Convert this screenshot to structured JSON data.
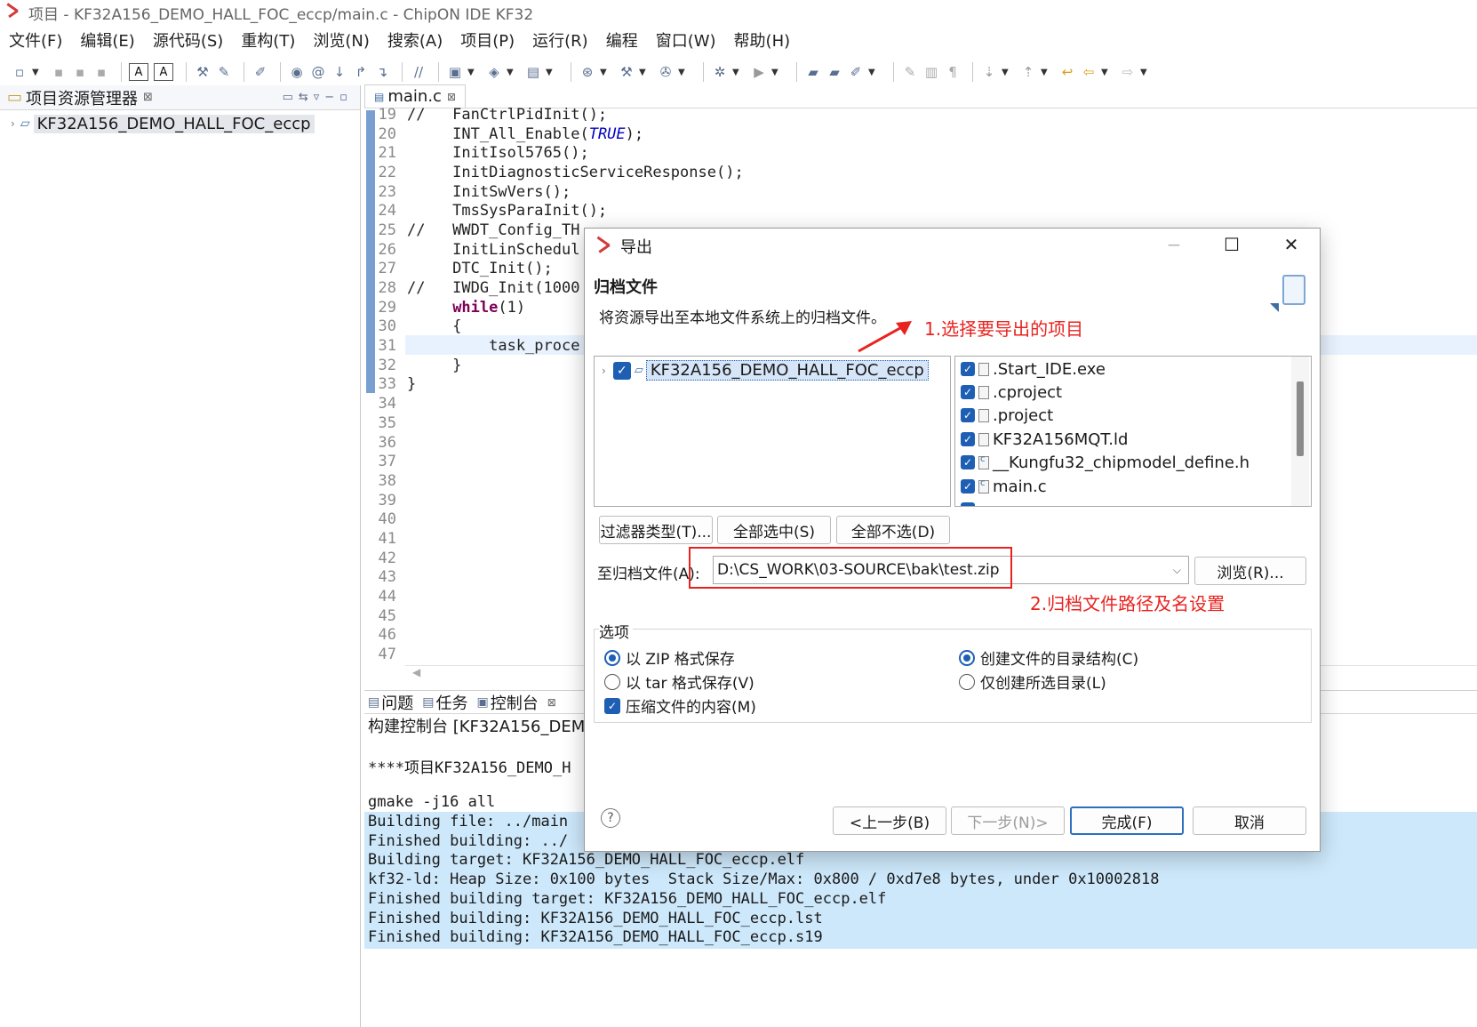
{
  "window": {
    "title": "项目  -  KF32A156_DEMO_HALL_FOC_eccp/main.c  -  ChipON IDE KF32"
  },
  "menu": [
    "文件(F)",
    "编辑(E)",
    "源代码(S)",
    "重构(T)",
    "浏览(N)",
    "搜索(A)",
    "项目(P)",
    "运行(R)",
    "编程",
    "窗口(W)",
    "帮助(H)"
  ],
  "explorer": {
    "title": "项目资源管理器",
    "project": "KF32A156_DEMO_HALL_FOC_eccp"
  },
  "editor": {
    "tab": "main.c",
    "lines": [
      {
        "n": "19",
        "t": "//   FanCtrlPidInit();"
      },
      {
        "n": "20",
        "t": "     INT_All_Enable(TRUE);"
      },
      {
        "n": "21",
        "t": "     InitIsol5765();"
      },
      {
        "n": "22",
        "t": "     InitDiagnosticServiceResponse();"
      },
      {
        "n": "23",
        "t": "     InitSwVers();"
      },
      {
        "n": "24",
        "t": "     TmsSysParaInit();"
      },
      {
        "n": "25",
        "t": "//   WWDT_Config_TH"
      },
      {
        "n": "26",
        "t": "     InitLinSchedul"
      },
      {
        "n": "27",
        "t": "     DTC_Init();"
      },
      {
        "n": "28",
        "t": "//   IWDG_Init(1000"
      },
      {
        "n": "29",
        "t": "     while(1)"
      },
      {
        "n": "30",
        "t": "     {"
      },
      {
        "n": "31",
        "t": "         task_proce"
      },
      {
        "n": "32",
        "t": "     }"
      },
      {
        "n": "33",
        "t": "}"
      },
      {
        "n": "34",
        "t": ""
      },
      {
        "n": "35",
        "t": ""
      },
      {
        "n": "36",
        "t": ""
      },
      {
        "n": "37",
        "t": ""
      },
      {
        "n": "38",
        "t": ""
      },
      {
        "n": "39",
        "t": ""
      },
      {
        "n": "40",
        "t": ""
      },
      {
        "n": "41",
        "t": ""
      },
      {
        "n": "42",
        "t": ""
      },
      {
        "n": "43",
        "t": ""
      },
      {
        "n": "44",
        "t": ""
      },
      {
        "n": "45",
        "t": ""
      },
      {
        "n": "46",
        "t": ""
      },
      {
        "n": "47",
        "t": ""
      }
    ]
  },
  "console": {
    "tabs": [
      "问题",
      "任务",
      "控制台"
    ],
    "title": "构建控制台 [KF32A156_DEMO_",
    "lines": [
      "****项目KF32A156_DEMO_H",
      "",
      "gmake -j16 all",
      "Building file: ../main",
      "Finished building: ../",
      "Building target: KF32A156_DEMO_HALL_FOC_eccp.elf",
      "kf32-ld: Heap Size: 0x100 bytes  Stack Size/Max: 0x800 / 0xd7e8 bytes, under 0x10002818",
      "Finished building target: KF32A156_DEMO_HALL_FOC_eccp.elf",
      "Finished building: KF32A156_DEMO_HALL_FOC_eccp.lst",
      "Finished building: KF32A156_DEMO_HALL_FOC_eccp.s19"
    ]
  },
  "dialog": {
    "title": "导出",
    "heading": "归档文件",
    "description": "将资源导出至本地文件系统上的归档文件。",
    "project": "KF32A156_DEMO_HALL_FOC_eccp",
    "files": [
      ".Start_IDE.exe",
      ".cproject",
      ".project",
      "KF32A156MQT.ld",
      "__Kungfu32_chipmodel_define.h",
      "main.c"
    ],
    "filter_button": "过滤器类型(T)...",
    "select_all_button": "全部选中(S)",
    "deselect_all_button": "全部不选(D)",
    "archive_label": "至归档文件(A):",
    "archive_path": "D:\\CS_WORK\\03-SOURCE\\bak\\test.zip",
    "browse_button": "浏览(R)...",
    "options_label": "选项",
    "opt_zip": "以 ZIP 格式保存",
    "opt_tar": "以 tar 格式保存(V)",
    "opt_compress": "压缩文件的内容(M)",
    "opt_dir_struct": "创建文件的目录结构(C)",
    "opt_selected_dirs": "仅创建所选目录(L)",
    "back_button": "<上一步(B)",
    "next_button": "下一步(N)>",
    "finish_button": "完成(F)",
    "cancel_button": "取消"
  },
  "annotations": {
    "step1": "1.选择要导出的项目",
    "step2": "2.归档文件路径及名设置"
  }
}
